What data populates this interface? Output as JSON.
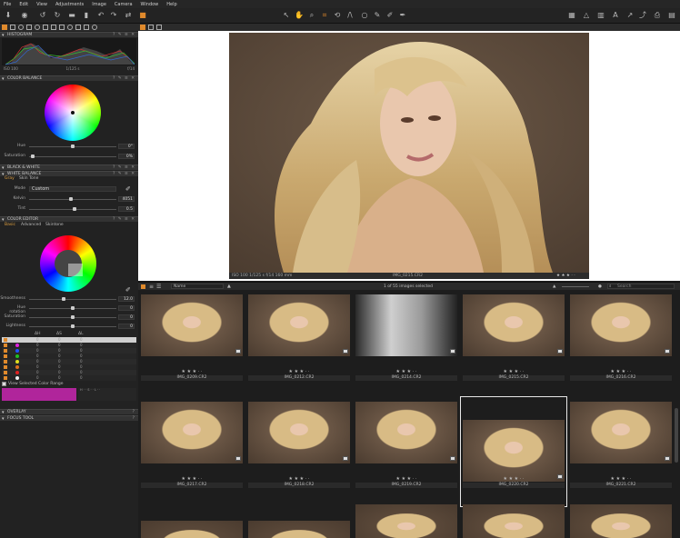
{
  "menu": [
    "File",
    "Edit",
    "View",
    "Adjustments",
    "Image",
    "Camera",
    "Window",
    "Help"
  ],
  "histogram": {
    "title": "HISTOGRAM",
    "iso": "ISO 100",
    "shutter": "1/125 s",
    "aperture": "f/14"
  },
  "color_balance": {
    "title": "COLOR BALANCE",
    "hue_label": "Hue",
    "hue_value": "0°",
    "sat_label": "Saturation",
    "sat_value": "0%"
  },
  "black_white": {
    "title": "BLACK & WHITE"
  },
  "white_balance": {
    "title": "WHITE BALANCE",
    "tab_gray": "Gray",
    "tab_skin": "Skin Tone",
    "mode_label": "Mode",
    "mode_value": "Custom",
    "kelvin_label": "Kelvin",
    "kelvin_value": "4051",
    "tint_label": "Tint",
    "tint_value": "0.5"
  },
  "color_editor": {
    "title": "COLOR EDITOR",
    "tabs": [
      "Basic",
      "Advanced",
      "Skintone"
    ],
    "smooth_label": "Smoothness",
    "smooth_value": "12.0",
    "hue_rot_label": "Hue rotation",
    "hue_rot_value": "0",
    "sat_label": "Saturation",
    "sat_value": "0",
    "light_label": "Lightness",
    "light_value": "0",
    "col_dh": "ΔH",
    "col_ds": "ΔS",
    "col_dl": "ΔL",
    "zero": "0",
    "view_selected": "View Selected Color Range"
  },
  "overlay": {
    "title": "OVERLAY"
  },
  "focus_tool": {
    "title": "FOCUS TOOL"
  },
  "viewer": {
    "status_left": "ISO 100  1/125 s  f/14  160 mm",
    "status_name": "IMG_0215.CR2"
  },
  "browser": {
    "sort_label": "Name",
    "count": "1 of 55 images selected",
    "search_placeholder": "Search",
    "rows": [
      [
        "IMG_0209.CR2",
        "IMG_0212.CR2",
        "IMG_0214.CR2",
        "IMG_0215.CR2",
        "IMG_0216.CR2"
      ],
      [
        "IMG_0217.CR2",
        "IMG_0218.CR2",
        "IMG_0219.CR2",
        "IMG_0220.CR2",
        "IMG_0221.CR2"
      ]
    ],
    "stars": "★ ★ ★ · ·"
  },
  "colors": {
    "accent": "#e08a2c",
    "magenta": "#b0259b"
  }
}
